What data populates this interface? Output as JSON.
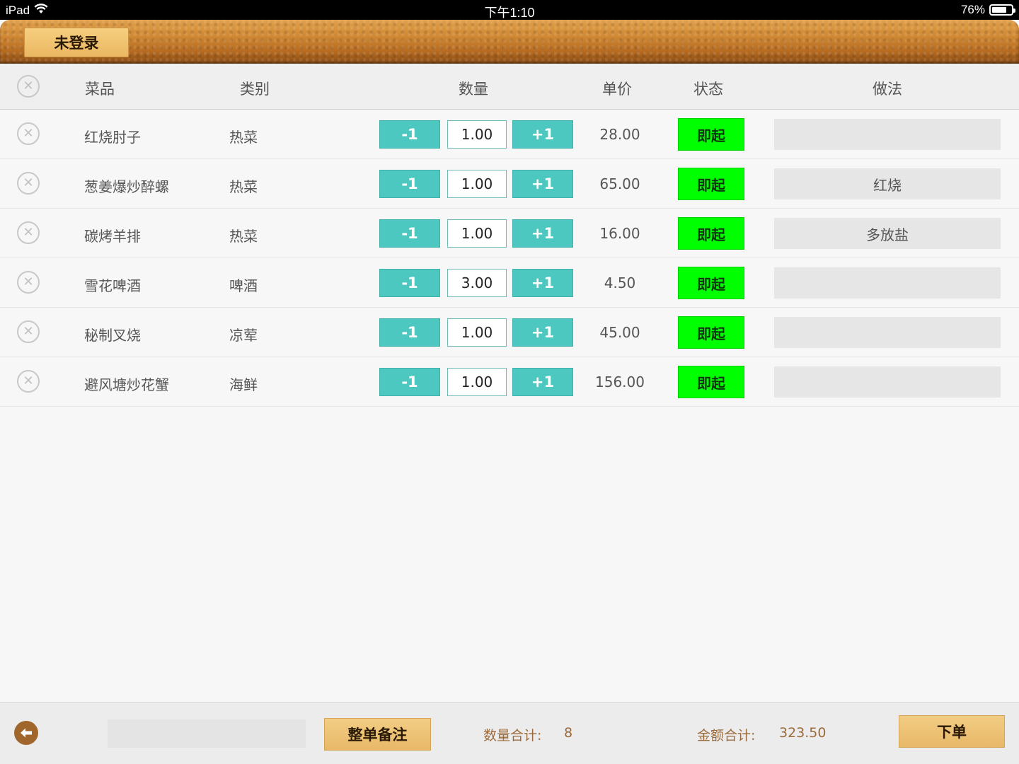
{
  "status_bar": {
    "device": "iPad",
    "time": "下午1:10",
    "battery": "76%",
    "battery_level": 0.76
  },
  "header": {
    "login_label": "未登录"
  },
  "table": {
    "columns": [
      "菜品",
      "类别",
      "数量",
      "单价",
      "状态",
      "做法"
    ],
    "decrement_label": "-1",
    "increment_label": "+1",
    "rows": [
      {
        "name": "红烧肘子",
        "category": "热菜",
        "qty": "1.00",
        "price": "28.00",
        "status": "即起",
        "method": ""
      },
      {
        "name": "葱姜爆炒醉螺",
        "category": "热菜",
        "qty": "1.00",
        "price": "65.00",
        "status": "即起",
        "method": "红烧"
      },
      {
        "name": "碳烤羊排",
        "category": "热菜",
        "qty": "1.00",
        "price": "16.00",
        "status": "即起",
        "method": "多放盐"
      },
      {
        "name": "雪花啤酒",
        "category": "啤酒",
        "qty": "3.00",
        "price": "4.50",
        "status": "即起",
        "method": ""
      },
      {
        "name": "秘制叉烧",
        "category": "凉荤",
        "qty": "1.00",
        "price": "45.00",
        "status": "即起",
        "method": ""
      },
      {
        "name": "避风塘炒花蟹",
        "category": "海鲜",
        "qty": "1.00",
        "price": "156.00",
        "status": "即起",
        "method": ""
      }
    ]
  },
  "footer": {
    "note_value": "",
    "remark_button": "整单备注",
    "qty_total_label": "数量合计:",
    "qty_total_value": "8",
    "amount_total_label": "金额合计:",
    "amount_total_value": "323.50",
    "order_button": "下单"
  },
  "colors": {
    "stepper": "#4dc8c0",
    "status": "#00ff00",
    "gold_button": "#ebb762",
    "header_leather": "#c97f2d"
  }
}
